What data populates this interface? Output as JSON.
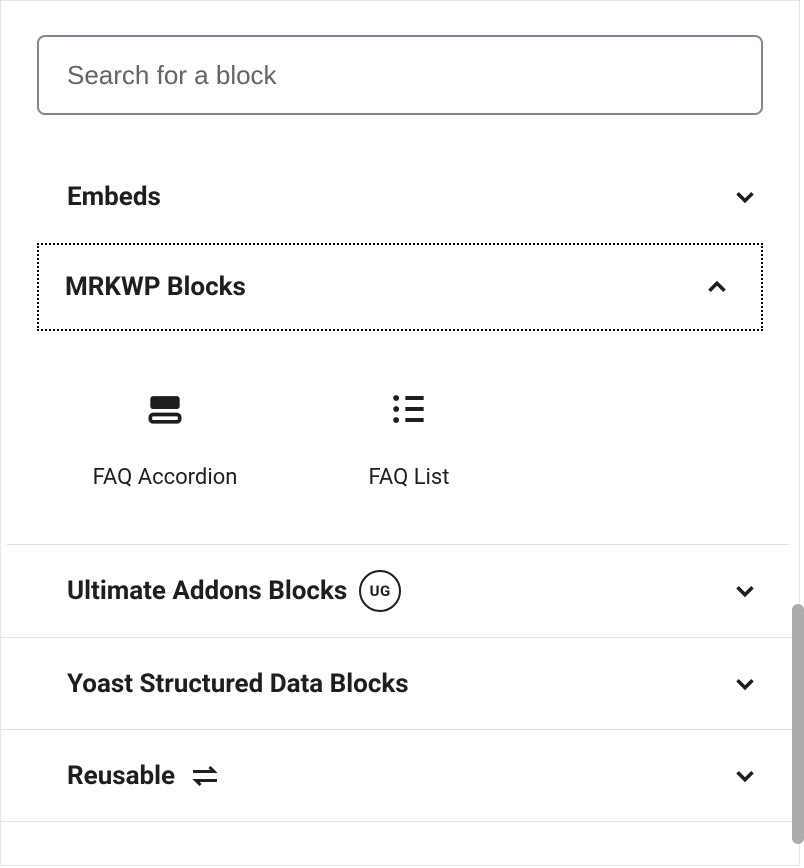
{
  "search": {
    "placeholder": "Search for a block",
    "value": ""
  },
  "categories": [
    {
      "key": "embeds",
      "label": "Embeds",
      "expanded": false
    },
    {
      "key": "mrkwp",
      "label": "MRKWP Blocks",
      "expanded": true,
      "blocks": [
        {
          "key": "faq-accordion",
          "label": "FAQ Accordion",
          "icon": "accordion"
        },
        {
          "key": "faq-list",
          "label": "FAQ List",
          "icon": "list"
        }
      ]
    },
    {
      "key": "ultimate",
      "label": "Ultimate Addons Blocks",
      "badge": "UG",
      "expanded": false
    },
    {
      "key": "yoast",
      "label": "Yoast Structured Data Blocks",
      "expanded": false
    },
    {
      "key": "reusable",
      "label": "Reusable",
      "icon": "loop",
      "expanded": false
    }
  ]
}
